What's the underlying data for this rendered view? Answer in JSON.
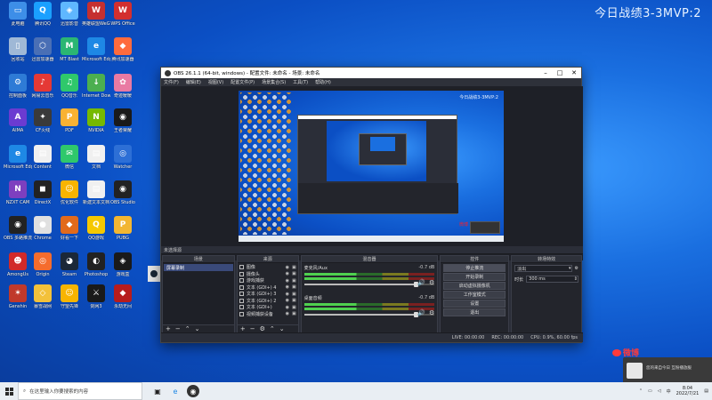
{
  "overlay_text": "今日战绩3-3MVP:2",
  "desktop_icons": [
    {
      "label": "此电脑",
      "glyph": "▭",
      "color": "#3d8ee8"
    },
    {
      "label": "腾讯QQ",
      "glyph": "Q",
      "color": "#1aa0ff"
    },
    {
      "label": "迅雷影音",
      "glyph": "◈",
      "color": "#5fb7ff"
    },
    {
      "label": "英雄联盟WeGame",
      "glyph": "W",
      "color": "#c53030"
    },
    {
      "label": "WPS Office",
      "glyph": "W",
      "color": "#d32f2f"
    },
    {
      "label": "回收站",
      "glyph": "▯",
      "color": "#9fb8d6"
    },
    {
      "label": "迅雷加速器",
      "glyph": "⬡",
      "color": "#4a6fb5"
    },
    {
      "label": "MT Blast",
      "glyph": "M",
      "color": "#2bb673"
    },
    {
      "label": "Microsoft Edge",
      "glyph": "e",
      "color": "#1e88e5"
    },
    {
      "label": "腾讯加速器",
      "glyph": "◆",
      "color": "#ff6b3d"
    },
    {
      "label": "控制面板",
      "glyph": "⚙",
      "color": "#2e7bd6"
    },
    {
      "label": "网易云音乐",
      "glyph": "♪",
      "color": "#e53935"
    },
    {
      "label": "QQ音乐",
      "glyph": "♫",
      "color": "#2fc86b"
    },
    {
      "label": "Internet Downloader",
      "glyph": "↓",
      "color": "#4caf50"
    },
    {
      "label": "奇迹暖暖",
      "glyph": "✿",
      "color": "#e97aa3"
    },
    {
      "label": "AIMA",
      "glyph": "A",
      "color": "#6b3bd1"
    },
    {
      "label": "CF火线",
      "glyph": "✦",
      "color": "#3a3a3a"
    },
    {
      "label": "PDF",
      "glyph": "P",
      "color": "#f9b233"
    },
    {
      "label": "NVIDIA",
      "glyph": "N",
      "color": "#76b900"
    },
    {
      "label": "王者荣耀",
      "glyph": "◉",
      "color": "#1a1a1a"
    },
    {
      "label": "Microsoft Edge",
      "glyph": "e",
      "color": "#1e88e5"
    },
    {
      "label": "Content",
      "glyph": "▤",
      "color": "#f0f0f0"
    },
    {
      "label": "微信",
      "glyph": "✉",
      "color": "#2fc86b"
    },
    {
      "label": "文档",
      "glyph": "▤",
      "color": "#f0f0f0"
    },
    {
      "label": "Watcher",
      "glyph": "◎",
      "color": "#2d6fd6"
    },
    {
      "label": "NZXT CAM",
      "glyph": "N",
      "color": "#7e3fbf"
    },
    {
      "label": "DirectX",
      "glyph": "◼",
      "color": "#222"
    },
    {
      "label": "优化软件",
      "glyph": "☺",
      "color": "#f8b400"
    },
    {
      "label": "新建文本文档",
      "glyph": "▤",
      "color": "#f0f0f0"
    },
    {
      "label": "OBS Studio",
      "glyph": "◉",
      "color": "#222"
    },
    {
      "label": "OBS 多路推流",
      "glyph": "◉",
      "color": "#222"
    },
    {
      "label": "Chrome",
      "glyph": "●",
      "color": "#e0e0e0"
    },
    {
      "label": "好看一下",
      "glyph": "◆",
      "color": "#e26a1b"
    },
    {
      "label": "QQ游戏",
      "glyph": "Q",
      "color": "#f5c800"
    },
    {
      "label": "PUBG",
      "glyph": "P",
      "color": "#f2b632"
    },
    {
      "label": "AmongUs",
      "glyph": "☻",
      "color": "#d12a2a"
    },
    {
      "label": "Origin",
      "glyph": "◎",
      "color": "#f56c2d"
    },
    {
      "label": "Steam",
      "glyph": "◕",
      "color": "#1b2838"
    },
    {
      "label": "Photoshop",
      "glyph": "◐",
      "color": "#222"
    },
    {
      "label": "游戏盒",
      "glyph": "◈",
      "color": "#1a1a1a"
    },
    {
      "label": "Genshin",
      "glyph": "✶",
      "color": "#c0392b"
    },
    {
      "label": "暴雪战网",
      "glyph": "◇",
      "color": "#f3c13a"
    },
    {
      "label": "守望先锋",
      "glyph": "☺",
      "color": "#f8b400"
    },
    {
      "label": "剑网3",
      "glyph": "⚔",
      "color": "#1a1a1a"
    },
    {
      "label": "永劫无间",
      "glyph": "◆",
      "color": "#b71c1c"
    }
  ],
  "obs": {
    "title": "OBS 26.1.1 (64-bit, windows) - 配置文件: 未命名 - 场景: 未命名",
    "menu": [
      "文件(F)",
      "编辑(E)",
      "视图(V)",
      "配置文件(P)",
      "场景集合(S)",
      "工具(T)",
      "帮助(H)"
    ],
    "preview_overlay": "今日战绩3-3MVP:2",
    "mini_weibo": "微博",
    "current_scene_label": "未选择源",
    "docks": {
      "scenes": "场景",
      "sources": "来源",
      "mixer": "混音器",
      "controls": "控件",
      "transitions": "转场特效"
    },
    "scene_items": [
      "屏幕录制"
    ],
    "source_items": [
      "图像",
      "摄像头",
      "游戏捕获",
      "文本 (GDI+) 4",
      "文本 (GDI+) 3",
      "文本 (GDI+) 2",
      "文本 (GDI+)",
      "视频捕获设备"
    ],
    "mixer_channels": [
      {
        "name": "麦克风/Aux",
        "db": "-0.7 dB"
      },
      {
        "name": "桌面音频",
        "db": "-0.7 dB"
      }
    ],
    "control_buttons": [
      "停止推流",
      "开始录制",
      "启动虚拟摄像机",
      "工作室模式",
      "设置",
      "退出"
    ],
    "transition_type": "淡出",
    "transition_duration_label": "时长",
    "transition_duration": "300 ms",
    "status": [
      "LIVE: 00:00:00",
      "REC: 00:00:00",
      "CPU: 0.9%, 60.00 fps"
    ]
  },
  "notification": {
    "text": "您的来自今日 互粉播放服"
  },
  "weibo_watermark": "微博",
  "taskbar": {
    "search_placeholder": "在这里输入你要搜索的内容",
    "time": "8:04",
    "date": "2022/7/21"
  }
}
